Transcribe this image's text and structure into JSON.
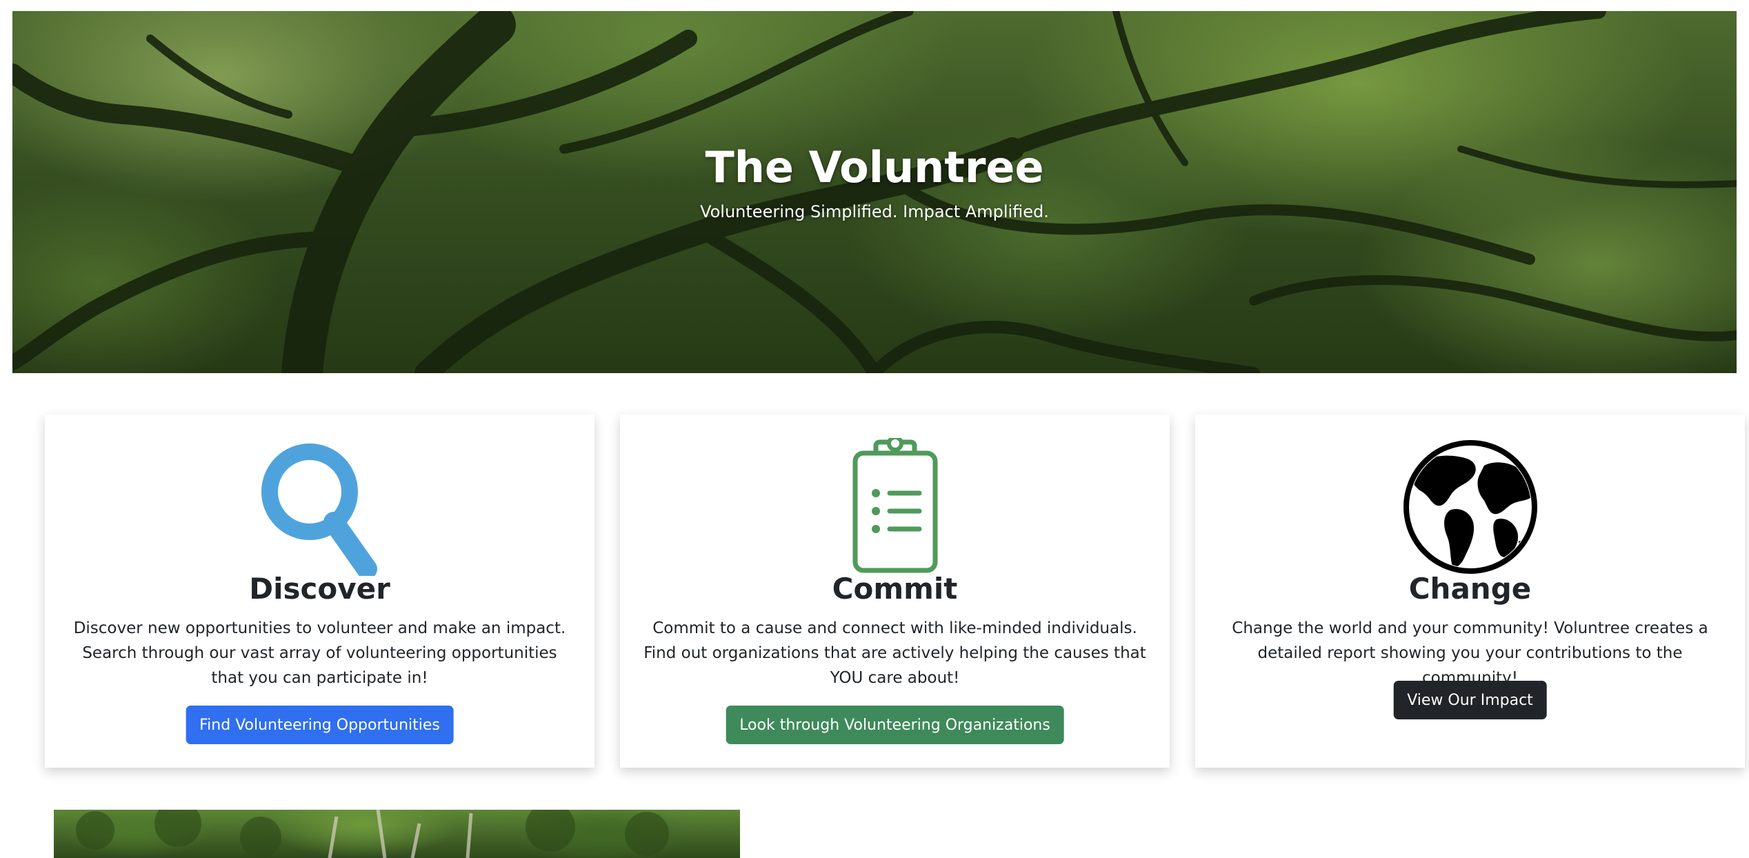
{
  "hero": {
    "title": "The Voluntree",
    "subtitle": "Volunteering Simplified. Impact Amplified."
  },
  "cards": [
    {
      "icon": "magnifying-glass-icon",
      "icon_color": "#4fa3dd",
      "title": "Discover",
      "description": "Discover new opportunities to volunteer and make an impact. Search through our vast array of volunteering opportunities that you can participate in!",
      "button_label": "Find Volunteering Opportunities",
      "button_color": "#2f6ff0"
    },
    {
      "icon": "clipboard-list-icon",
      "icon_color": "#4f9a5a",
      "title": "Commit",
      "description": "Commit to a cause and connect with like-minded individuals. Find out organizations that are actively helping the causes that YOU care about!",
      "button_label": "Look through Volunteering Organizations",
      "button_color": "#3e8a5a"
    },
    {
      "icon": "globe-icon",
      "icon_color": "#000000",
      "title": "Change",
      "description": "Change the world and your community! Voluntree creates a detailed report showing you your contributions to the community!",
      "button_label": "View Our Impact",
      "button_color": "#212529"
    }
  ]
}
